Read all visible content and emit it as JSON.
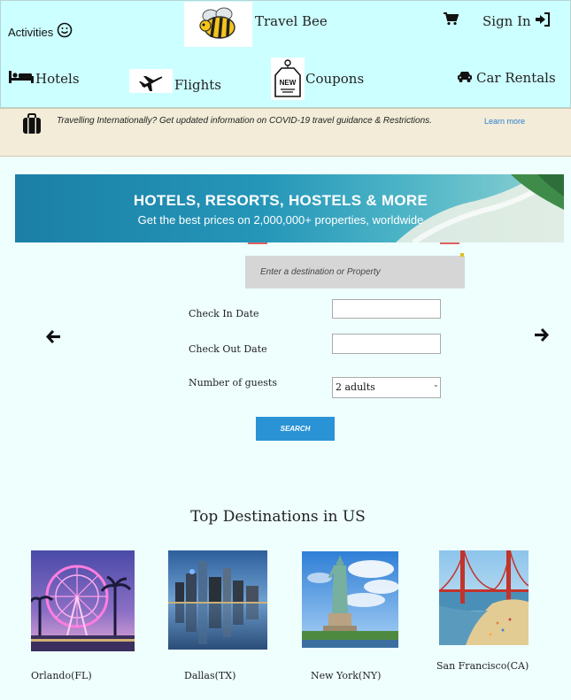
{
  "header": {
    "activities_label": "Activities",
    "brand_name": "Travel Bee",
    "sign_in_label": "Sign In",
    "nav": {
      "hotels_label": "Hotels",
      "flights_label": "Flights",
      "coupons_label": "Coupons",
      "coupon_badge": "NEW",
      "car_rentals_label": "Car Rentals"
    }
  },
  "notice": {
    "text": "Travelling Internationally? Get updated information on COVID-19 travel guidance & Restrictions.",
    "link_label": "Learn more"
  },
  "banner": {
    "headline": "HOTELS, RESORTS, HOSTELS & MORE",
    "subline": "Get the best prices on 2,000,000+ properties, worldwide"
  },
  "search": {
    "destination_placeholder": "Enter a destination or Property",
    "check_in_label": "Check In Date",
    "check_out_label": "Check Out Date",
    "guests_label": "Number of guests",
    "guests_value": "2 adults",
    "search_button_label": "SEARCH"
  },
  "destinations": {
    "heading": "Top Destinations in US",
    "cities": [
      {
        "name": "Orlando(FL)"
      },
      {
        "name": "Dallas(TX)"
      },
      {
        "name": "New York(NY)"
      },
      {
        "name": "San Francisco(CA)"
      }
    ]
  },
  "colors": {
    "topbar_bg": "#ccffff",
    "page_bg": "#eefffe",
    "notice_bg": "#f2ecd8",
    "link": "#2a7fd4",
    "search_button": "#2a93d5"
  }
}
